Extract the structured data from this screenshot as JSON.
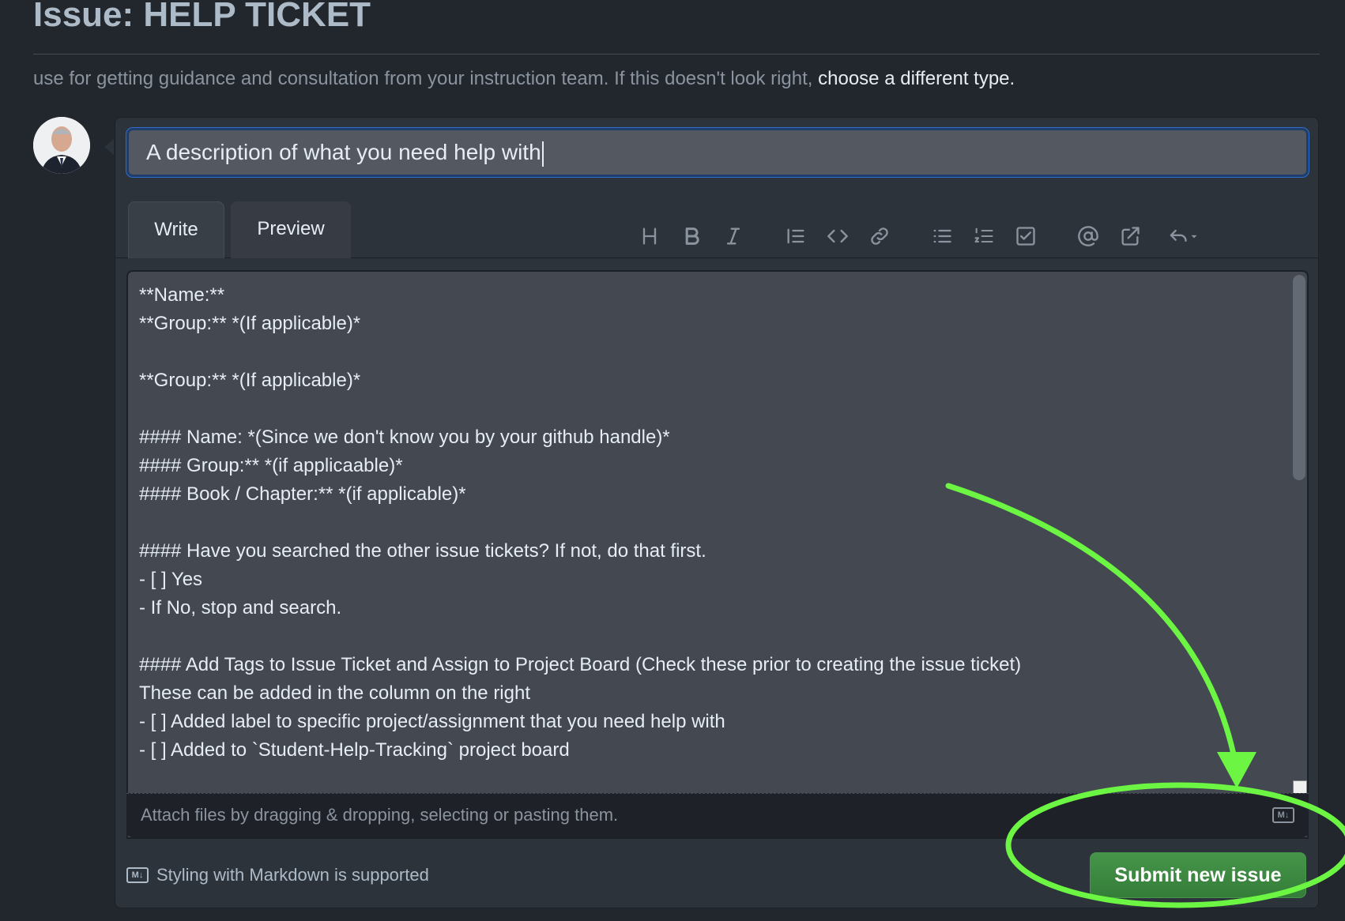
{
  "header": {
    "title": "Issue: HELP TICKET",
    "description": "use for getting guidance and consultation from your instruction team. If this doesn't look right, ",
    "change_link": "choose a different type."
  },
  "form": {
    "title_value": "A description of what you need help with",
    "tabs": [
      {
        "label": "Write"
      },
      {
        "label": "Preview"
      }
    ],
    "toolbar": {
      "heading": "heading-icon",
      "bold": "bold-icon",
      "italic": "italic-icon",
      "quote": "quote-icon",
      "code": "code-icon",
      "link": "link-icon",
      "unordered_list": "unordered-list-icon",
      "ordered_list": "ordered-list-icon",
      "task_list": "task-list-icon",
      "mention": "mention-icon",
      "reference": "cross-reference-icon",
      "undo": "undo-icon"
    },
    "body_lines": [
      "**Name:**",
      "**Group:** *(If applicable)*",
      "",
      "**Group:** *(If applicable)*",
      "",
      "#### Name: *(Since we don't know you by your github handle)*",
      "#### Group:** *(if applicaable)*",
      "#### Book / Chapter:** *(if applicable)*",
      "",
      "#### Have you searched the other issue tickets? If not, do that first.",
      "- [ ] Yes",
      "- If No, stop and search.",
      "",
      "#### Add Tags to Issue Ticket and Assign to Project Board (Check these prior to creating the issue ticket)",
      "These can be added in the column on the right",
      "- [ ] Added label to specific project/assignment that you need help with",
      "- [ ] Added to `Student-Help-Tracking` project board"
    ],
    "attach_hint": "Attach files by dragging & dropping, selecting or pasting them.",
    "markdown_note": "Styling with Markdown is supported",
    "md_badge": "M↓",
    "submit_label": "Submit new issue"
  },
  "annotation": {
    "color": "#6cf542"
  }
}
